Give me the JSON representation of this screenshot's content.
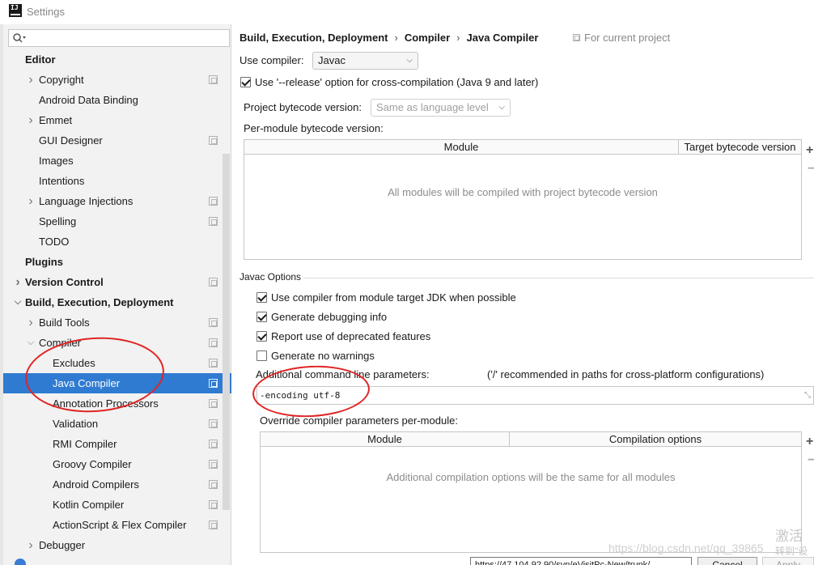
{
  "window": {
    "title": "Settings",
    "app_icon_text": "IJ"
  },
  "search": {
    "placeholder": "",
    "value": ""
  },
  "tree": [
    {
      "label": "Editor",
      "bold": true,
      "indent": 0,
      "arrow": "",
      "proj": false
    },
    {
      "label": "Copyright",
      "indent": 1,
      "arrow": "right",
      "proj": true
    },
    {
      "label": "Android Data Binding",
      "indent": 1,
      "arrow": "",
      "proj": false
    },
    {
      "label": "Emmet",
      "indent": 1,
      "arrow": "right",
      "proj": false
    },
    {
      "label": "GUI Designer",
      "indent": 1,
      "arrow": "",
      "proj": true
    },
    {
      "label": "Images",
      "indent": 1,
      "arrow": "",
      "proj": false
    },
    {
      "label": "Intentions",
      "indent": 1,
      "arrow": "",
      "proj": false
    },
    {
      "label": "Language Injections",
      "indent": 1,
      "arrow": "right",
      "proj": true
    },
    {
      "label": "Spelling",
      "indent": 1,
      "arrow": "",
      "proj": true
    },
    {
      "label": "TODO",
      "indent": 1,
      "arrow": "",
      "proj": false
    },
    {
      "label": "Plugins",
      "bold": true,
      "indent": 0,
      "arrow": "",
      "proj": false
    },
    {
      "label": "Version Control",
      "bold": true,
      "indent": 0,
      "arrow": "right",
      "proj": true
    },
    {
      "label": "Build, Execution, Deployment",
      "bold": true,
      "indent": 0,
      "arrow": "down",
      "proj": false
    },
    {
      "label": "Build Tools",
      "indent": 1,
      "arrow": "right",
      "proj": true
    },
    {
      "label": "Compiler",
      "indent": 1,
      "arrow": "down",
      "proj": true
    },
    {
      "label": "Excludes",
      "indent": 2,
      "arrow": "",
      "proj": true
    },
    {
      "label": "Java Compiler",
      "indent": 2,
      "arrow": "",
      "proj": true,
      "selected": true
    },
    {
      "label": "Annotation Processors",
      "indent": 2,
      "arrow": "",
      "proj": true
    },
    {
      "label": "Validation",
      "indent": 2,
      "arrow": "",
      "proj": true
    },
    {
      "label": "RMI Compiler",
      "indent": 2,
      "arrow": "",
      "proj": true
    },
    {
      "label": "Groovy Compiler",
      "indent": 2,
      "arrow": "",
      "proj": true
    },
    {
      "label": "Android Compilers",
      "indent": 2,
      "arrow": "",
      "proj": true
    },
    {
      "label": "Kotlin Compiler",
      "indent": 2,
      "arrow": "",
      "proj": true
    },
    {
      "label": "ActionScript & Flex Compiler",
      "indent": 2,
      "arrow": "",
      "proj": true
    },
    {
      "label": "Debugger",
      "indent": 1,
      "arrow": "right",
      "proj": false
    }
  ],
  "breadcrumb": {
    "items": [
      "Build, Execution, Deployment",
      "Compiler",
      "Java Compiler"
    ],
    "separator": "›",
    "scope": "For current project"
  },
  "compiler": {
    "use_compiler_label": "Use compiler:",
    "use_compiler_value": "Javac",
    "release_option_label": "Use '--release' option for cross-compilation (Java 9 and later)",
    "release_option_checked": true,
    "bytecode_label": "Project bytecode version:",
    "bytecode_value": "Same as language level",
    "per_module_label": "Per-module bytecode version:"
  },
  "module_table": {
    "columns": [
      "Module",
      "Target bytecode version"
    ],
    "empty_text": "All modules will be compiled with project bytecode version"
  },
  "javac": {
    "section_title": "Javac Options",
    "options": [
      {
        "label": "Use compiler from module target JDK when possible",
        "checked": true
      },
      {
        "label": "Generate debugging info",
        "checked": true
      },
      {
        "label": "Report use of deprecated features",
        "checked": true
      },
      {
        "label": "Generate no warnings",
        "checked": false
      }
    ],
    "params_label": "Additional command line parameters:",
    "params_hint": "('/' recommended in paths for cross-platform configurations)",
    "params_value": "-encoding utf-8",
    "override_label": "Override compiler parameters per-module:"
  },
  "override_table": {
    "columns": [
      "Module",
      "Compilation options"
    ],
    "empty_text": "Additional compilation options will be the same for all modules"
  },
  "bottom": {
    "url_text": "https://47.104.92.90/svn/eVisitPc-New/trunk/",
    "cancel_label": "Cancel",
    "apply_label": "Apply"
  },
  "watermark": {
    "url": "https://blog.csdn.net/qq_39865",
    "cn_line1": "激活",
    "cn_line2": "转到\"设"
  },
  "colors": {
    "selection": "#2f7bd1",
    "annotation": "#e02424"
  }
}
